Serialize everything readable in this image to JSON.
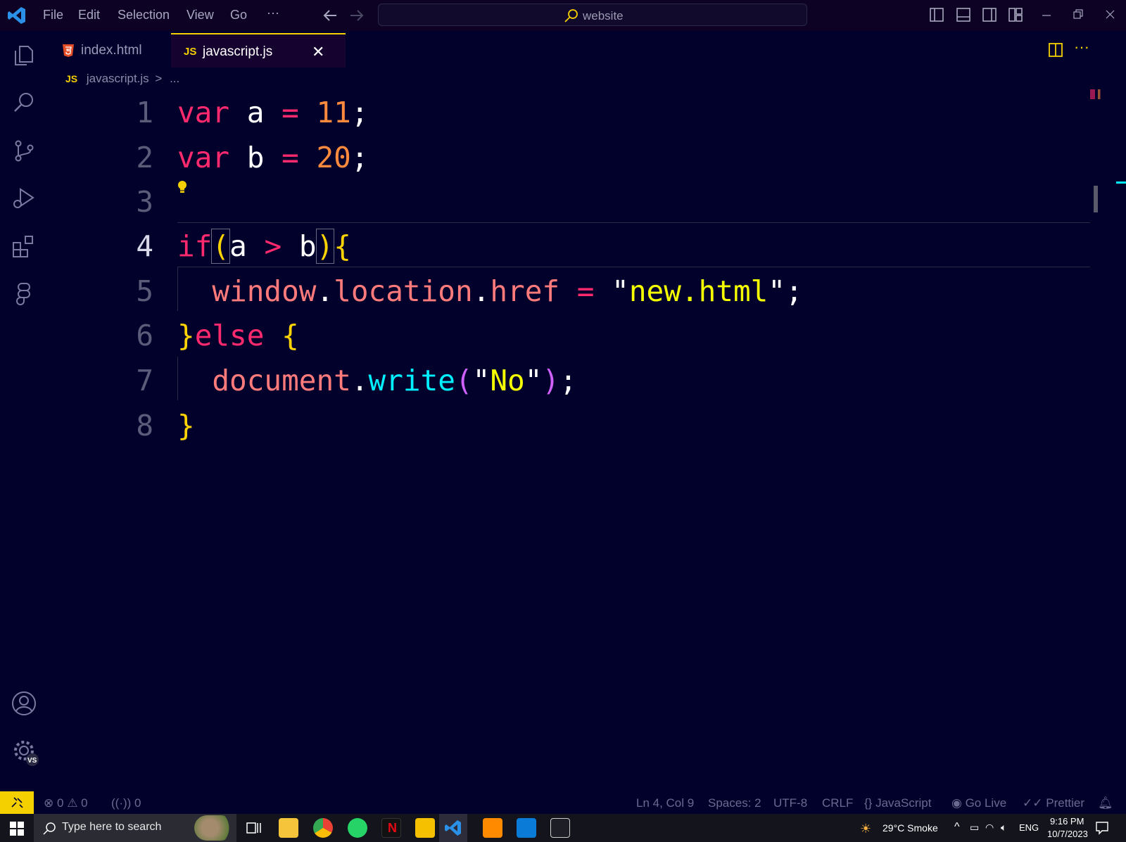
{
  "titlebar": {
    "menu": [
      "File",
      "Edit",
      "Selection",
      "View",
      "Go",
      "···"
    ],
    "search_text": "website"
  },
  "tabs": [
    {
      "label": "index.html",
      "icon": "html5-icon",
      "active": false
    },
    {
      "label": "javascript.js",
      "icon": "js-icon",
      "prefix": "JS",
      "active": true,
      "close": "✕"
    }
  ],
  "breadcrumb": {
    "prefix": "JS",
    "file": "javascript.js",
    "sep": ">",
    "more": "..."
  },
  "editor": {
    "line_numbers": [
      "1",
      "2",
      "3",
      "4",
      "5",
      "6",
      "7",
      "8"
    ],
    "active_line": "4",
    "code": {
      "l1": {
        "kw": "var",
        "id": "a",
        "op": "=",
        "num": "11",
        "end": ";"
      },
      "l2": {
        "kw": "var",
        "id": "b",
        "op": "=",
        "num": "20",
        "end": ";"
      },
      "l4": {
        "kw": "if",
        "open": "(",
        "a": "a",
        "op": ">",
        "b": "b",
        "close": ")",
        "brace": "{"
      },
      "l5": {
        "obj": "window",
        "dot1": ".",
        "prop1": "location",
        "dot2": ".",
        "prop2": "href",
        "op": "=",
        "q1": "\"",
        "str": "new.html",
        "q2": "\"",
        "end": ";"
      },
      "l6": {
        "close": "}",
        "kw": "else",
        "open": "{"
      },
      "l7": {
        "obj": "document",
        "dot": ".",
        "fn": "write",
        "p1": "(",
        "q1": "\"",
        "str": "No",
        "q2": "\"",
        "p2": ")",
        "end": ";"
      },
      "l8": {
        "close": "}"
      }
    }
  },
  "status": {
    "errors": "0",
    "warnings": "0",
    "ports": "0",
    "position": "Ln 4, Col 9",
    "spaces": "Spaces: 2",
    "encoding": "UTF-8",
    "eol": "CRLF",
    "language": "JavaScript",
    "golive": "Go Live",
    "prettier": "Prettier"
  },
  "taskbar": {
    "search_placeholder": "Type here to search",
    "weather": "29°C  Smoke",
    "lang": "ENG",
    "time": "9:16 PM",
    "date": "10/7/2023"
  },
  "colors": {
    "background": "#01012b",
    "keyword": "#ff2a6d",
    "number": "#ff8a3d",
    "string": "#f5ff00",
    "function": "#00f0ff",
    "bracket": "#ffd400",
    "accent": "#f5d000"
  }
}
